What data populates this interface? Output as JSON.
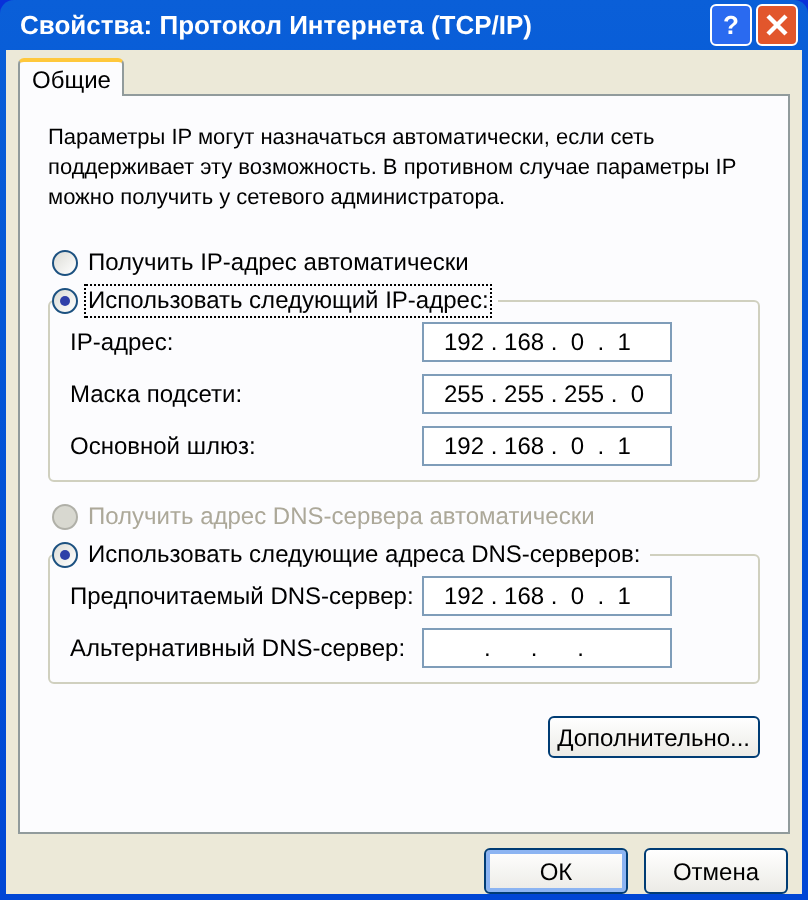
{
  "window": {
    "title": "Свойства: Протокол Интернета (TCP/IP)",
    "help_button": "?"
  },
  "tabs": [
    {
      "label": "Общие",
      "selected": true
    }
  ],
  "description": "Параметры IP могут назначаться автоматически, если сеть поддерживает эту возможность. В противном случае параметры IP можно получить у сетевого администратора.",
  "ip_options": [
    {
      "label": "Получить IP-адрес автоматически",
      "selected": false,
      "disabled": false,
      "focused": false
    },
    {
      "label": "Использовать следующий IP-адрес:",
      "selected": true,
      "disabled": false,
      "focused": true
    }
  ],
  "ip_fields": [
    {
      "label": "IP-адрес:",
      "value": "192 . 168 .  0  .  1"
    },
    {
      "label": "Маска подсети:",
      "value": "255 . 255 . 255 .  0"
    },
    {
      "label": "Основной шлюз:",
      "value": "192 . 168 .  0  .  1"
    }
  ],
  "dns_options": [
    {
      "label": "Получить адрес DNS-сервера автоматически",
      "selected": false,
      "disabled": true,
      "focused": false
    },
    {
      "label": "Использовать следующие адреса DNS-серверов:",
      "selected": true,
      "disabled": false,
      "focused": false
    }
  ],
  "dns_fields": [
    {
      "label": "Предпочитаемый DNS-сервер:",
      "value": "192 . 168 .  0  .  1"
    },
    {
      "label": "Альтернативный DNS-сервер:",
      "value": "      .      .      ."
    }
  ],
  "advanced_button": "Дополнительно...",
  "buttons": [
    {
      "label": "ОК",
      "default": true
    },
    {
      "label": "Отмена",
      "default": false
    }
  ]
}
